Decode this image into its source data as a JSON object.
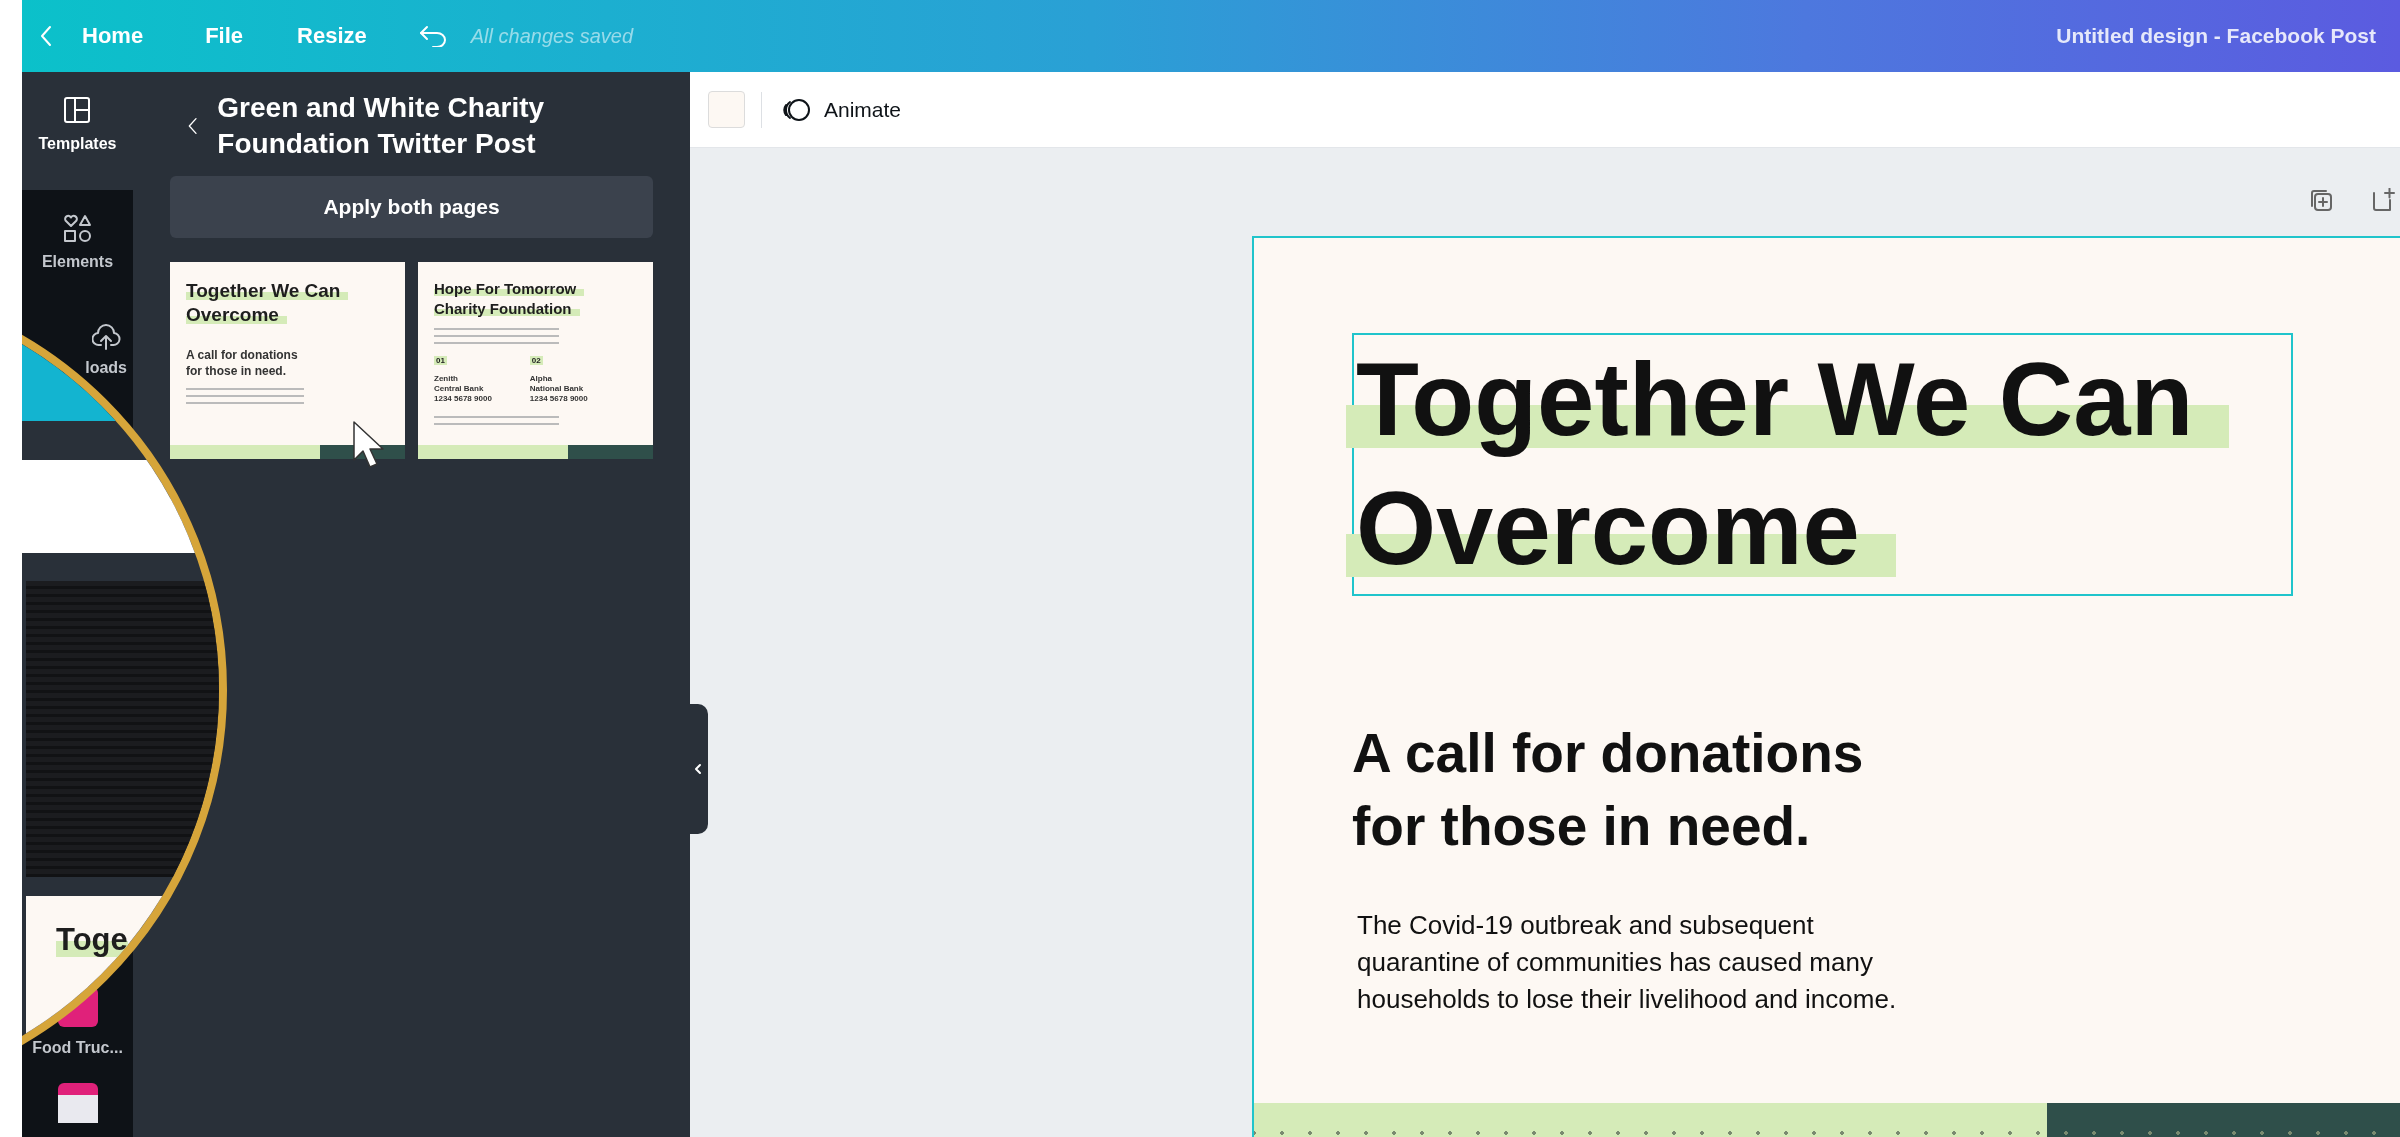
{
  "top_bar": {
    "back_label": "Home",
    "menu": [
      "File",
      "Resize"
    ],
    "save_status": "All changes saved",
    "document_title": "Untitled design - Facebook Post"
  },
  "side_rail": {
    "items": [
      {
        "kind": "templates",
        "label": "Templates",
        "selected": true
      },
      {
        "kind": "elements",
        "label": "Elements",
        "selected": false
      },
      {
        "kind": "uploads",
        "label": "loads",
        "selected": false
      }
    ],
    "apps": [
      {
        "label": "Food Truc..."
      }
    ]
  },
  "template_panel": {
    "title": "Green and White Charity Foundation Twitter Post",
    "apply_button": "Apply both pages",
    "pages": [
      {
        "kind": "appeal",
        "heading_lines": [
          "Together We Can",
          "Overcome"
        ],
        "subheading_lines": [
          "A call for donations",
          "for those in need."
        ]
      },
      {
        "kind": "accounts",
        "heading_lines": [
          "Hope For Tomorrow",
          "Charity Foundation"
        ],
        "accounts": [
          {
            "number": "01",
            "name": "Zenith",
            "bank": "Central Bank",
            "account": "1234 5678 9000"
          },
          {
            "number": "02",
            "name": "Alpha",
            "bank": "National Bank",
            "account": "1234 5678 9000"
          }
        ]
      }
    ]
  },
  "toolbar": {
    "animate_label": "Animate"
  },
  "design": {
    "heading": {
      "lines": [
        "Together We Can",
        "Overcome"
      ],
      "selected": true
    },
    "subheading_lines": [
      "A call for donations",
      "for those in need."
    ],
    "body_lines": [
      "The Covid-19 outbreak and subsequent",
      "quarantine of communities has caused many",
      "households to lose their livelihood and income."
    ]
  },
  "magnifier": {
    "thumbnail_heading_lines": [
      "Toge"
    ]
  }
}
